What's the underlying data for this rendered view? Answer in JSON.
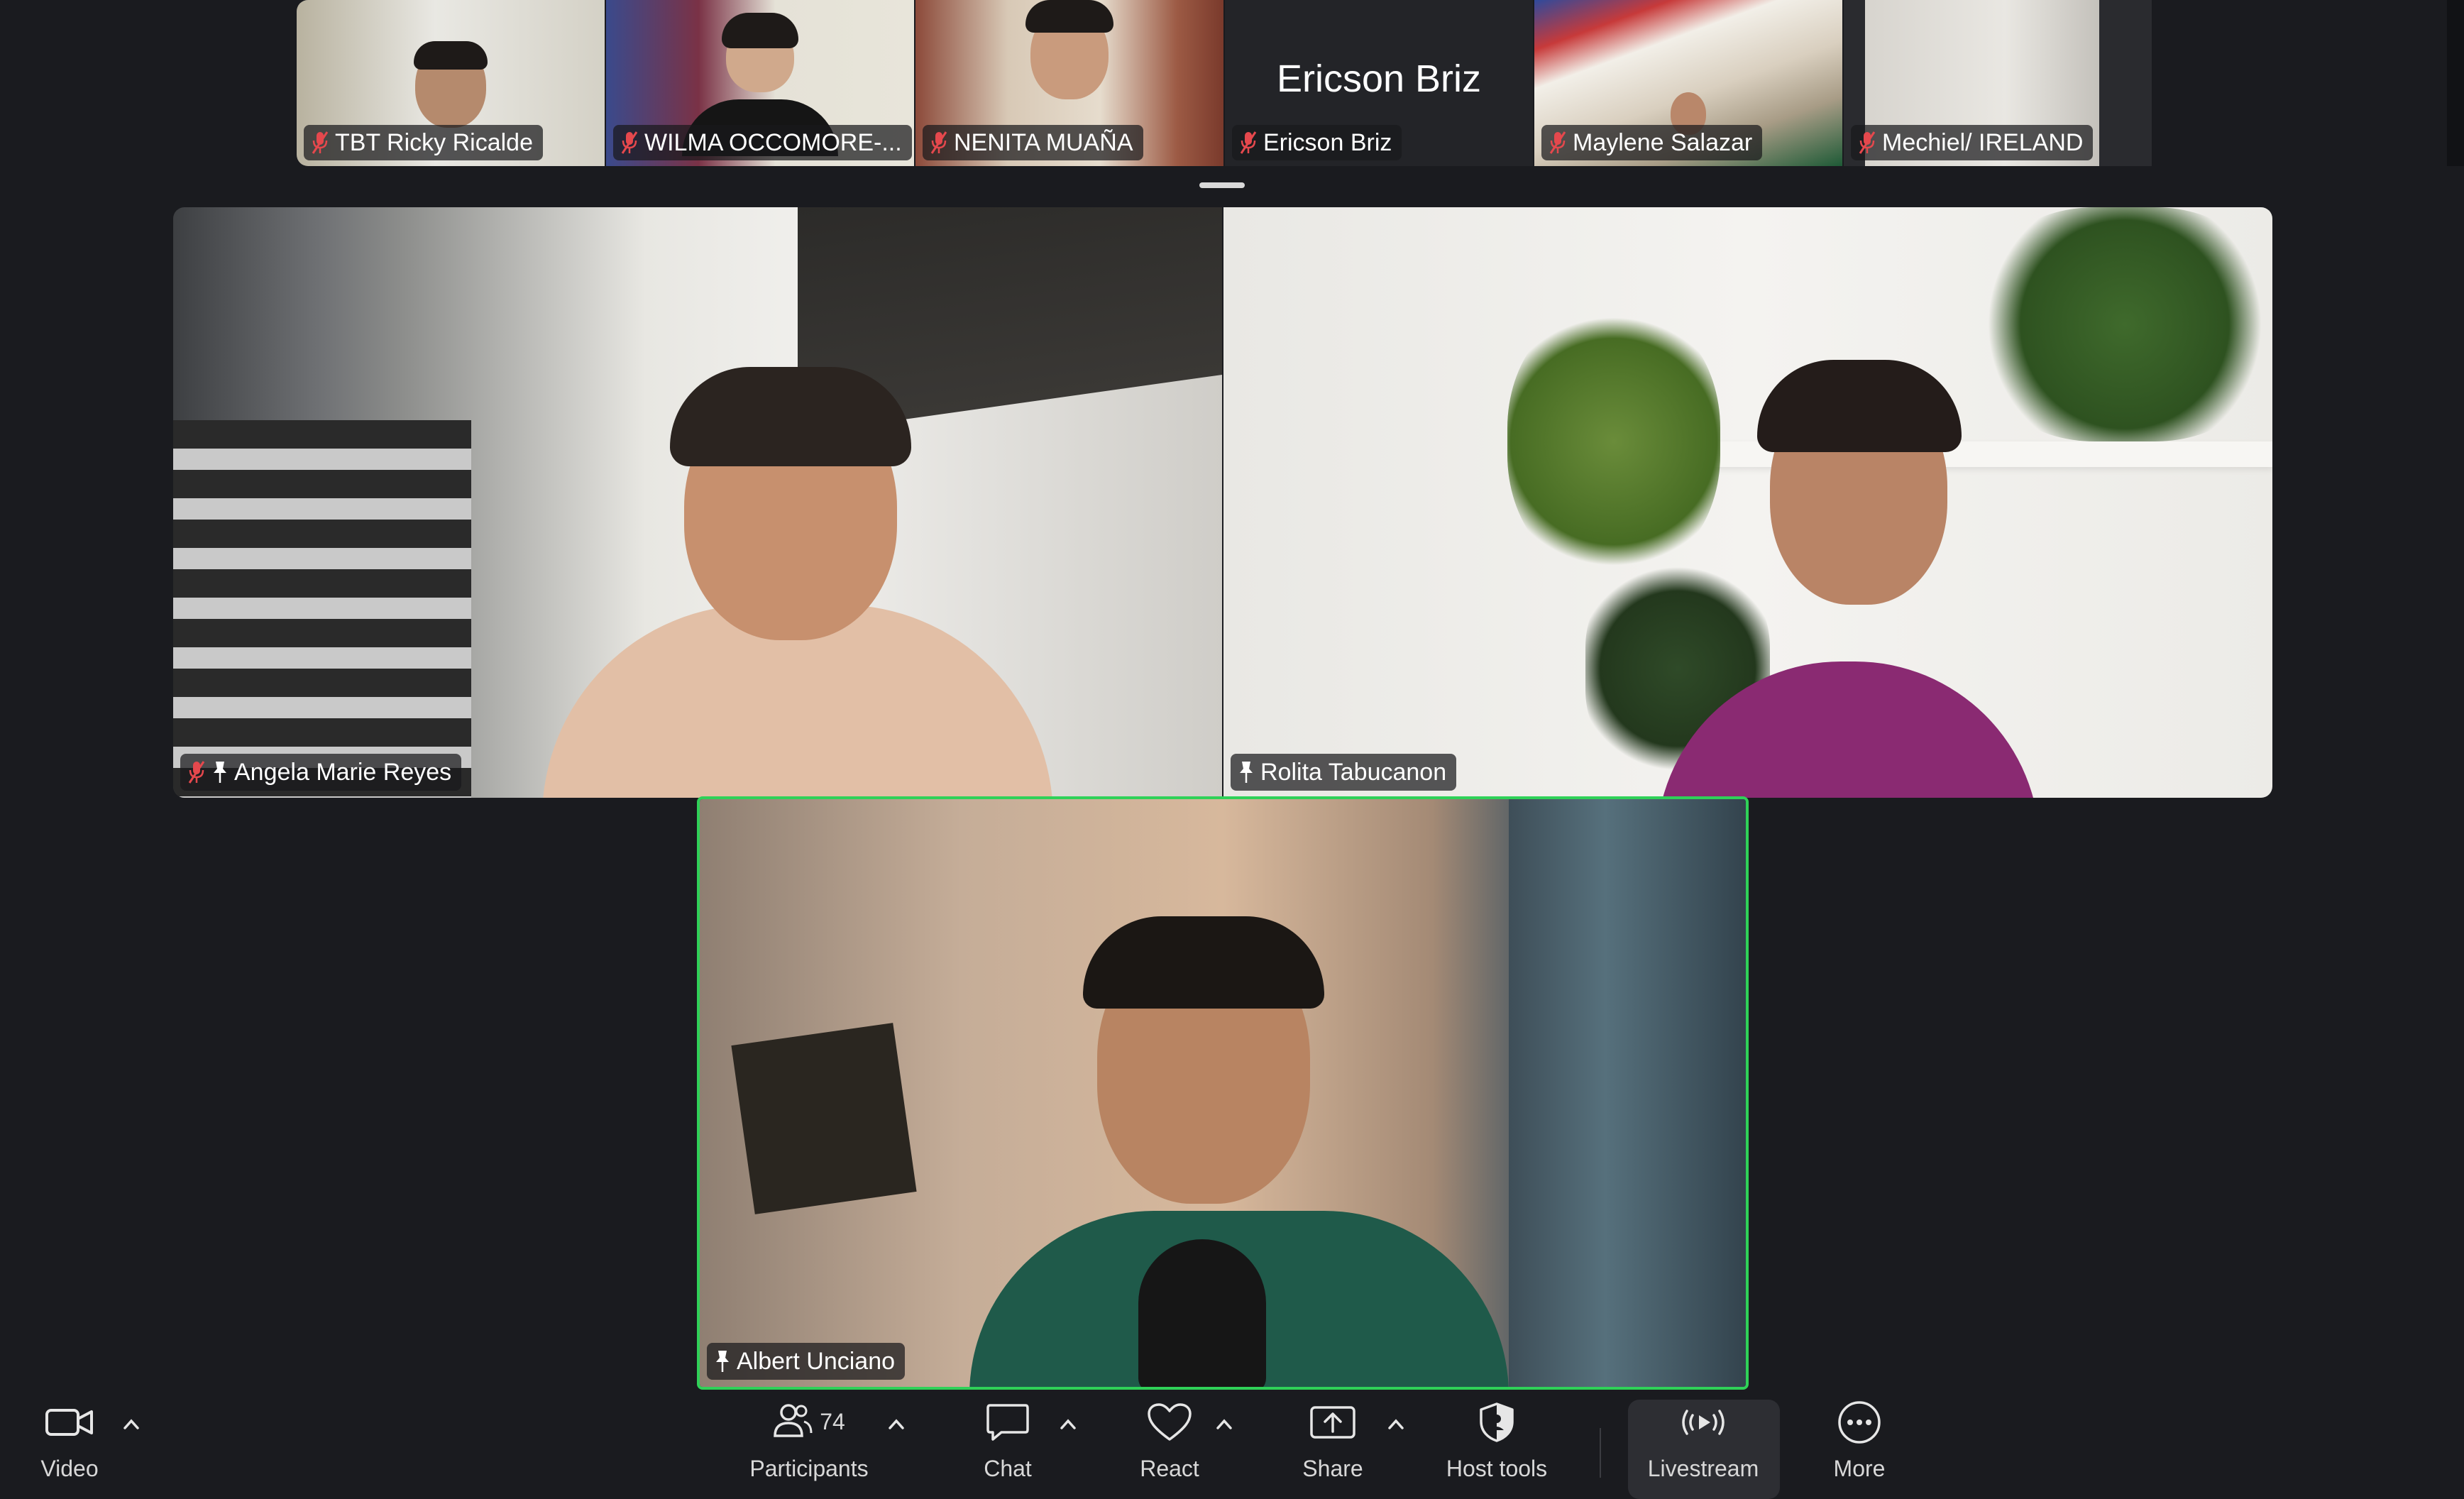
{
  "filmstrip": {
    "tiles": [
      {
        "name": "TBT Ricky Ricalde",
        "muted": true
      },
      {
        "name": "WILMA OCCOMORE-...",
        "muted": true
      },
      {
        "name": "NENITA MUAÑA",
        "muted": true
      },
      {
        "name": "Ericson Briz",
        "muted": true,
        "display_name": "Ericson Briz"
      },
      {
        "name": "Maylene Salazar",
        "muted": true
      },
      {
        "name": "Mechiel/ IRELAND",
        "muted": true
      }
    ],
    "next_icon": "chevron-right-icon"
  },
  "gallery": {
    "tiles": [
      {
        "name": "Angela Marie Reyes",
        "muted": true,
        "pinned": true
      },
      {
        "name": "Rolita Tabucanon",
        "muted": false,
        "pinned": true
      },
      {
        "name": "Albert Unciano",
        "muted": false,
        "pinned": true,
        "active_speaker": true
      }
    ]
  },
  "toolbar": {
    "video": {
      "label": "Video",
      "icon": "video-camera-icon"
    },
    "participants": {
      "label": "Participants",
      "count": "74",
      "icon": "participants-icon"
    },
    "chat": {
      "label": "Chat",
      "icon": "chat-bubble-icon"
    },
    "react": {
      "label": "React",
      "icon": "heart-icon"
    },
    "share": {
      "label": "Share",
      "icon": "share-screen-icon"
    },
    "host_tools": {
      "label": "Host tools",
      "icon": "shield-icon"
    },
    "livestream": {
      "label": "Livestream",
      "icon": "livestream-icon"
    },
    "more": {
      "label": "More",
      "icon": "more-dots-icon"
    }
  },
  "colors": {
    "background": "#1a1b1f",
    "active_speaker_border": "#2fd158",
    "muted_mic": "#e5484d"
  }
}
